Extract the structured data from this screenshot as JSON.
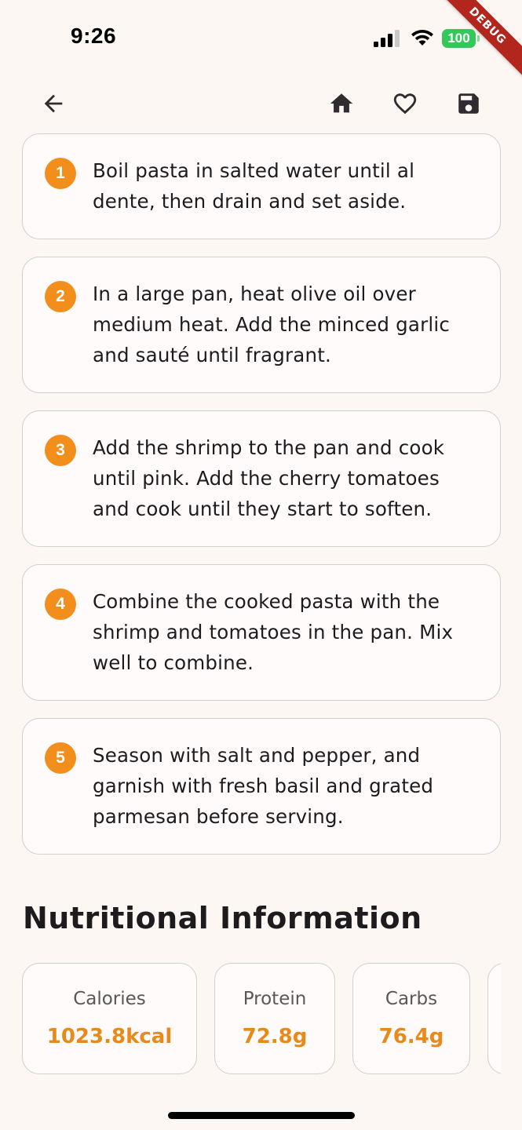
{
  "status_bar": {
    "time": "9:26",
    "battery": "100"
  },
  "debug_banner": "DEBUG",
  "app_bar": {
    "back_icon": "arrow-back-icon",
    "actions": [
      "home-icon",
      "heart-outline-icon",
      "save-icon"
    ]
  },
  "steps": [
    {
      "number": "1",
      "text": "Boil pasta in salted water until al dente, then drain and set aside."
    },
    {
      "number": "2",
      "text": "In a large pan, heat olive oil over medium heat. Add the minced garlic and sauté until fragrant."
    },
    {
      "number": "3",
      "text": "Add the shrimp to the pan and cook until pink. Add the cherry tomatoes and cook until they start to soften."
    },
    {
      "number": "4",
      "text": "Combine the cooked pasta with the shrimp and tomatoes in the pan. Mix well to combine."
    },
    {
      "number": "5",
      "text": "Season with salt and pepper, and garnish with fresh basil and grated parmesan before serving."
    }
  ],
  "nutrition": {
    "title": "Nutritional Information",
    "items": [
      {
        "label": "Calories",
        "value": "1023.8kcal"
      },
      {
        "label": "Protein",
        "value": "72.8g"
      },
      {
        "label": "Carbs",
        "value": "76.4g"
      }
    ]
  },
  "colors": {
    "accent": "#f18e1c",
    "value_text": "#e88a1a",
    "background": "#fdf7f4"
  }
}
